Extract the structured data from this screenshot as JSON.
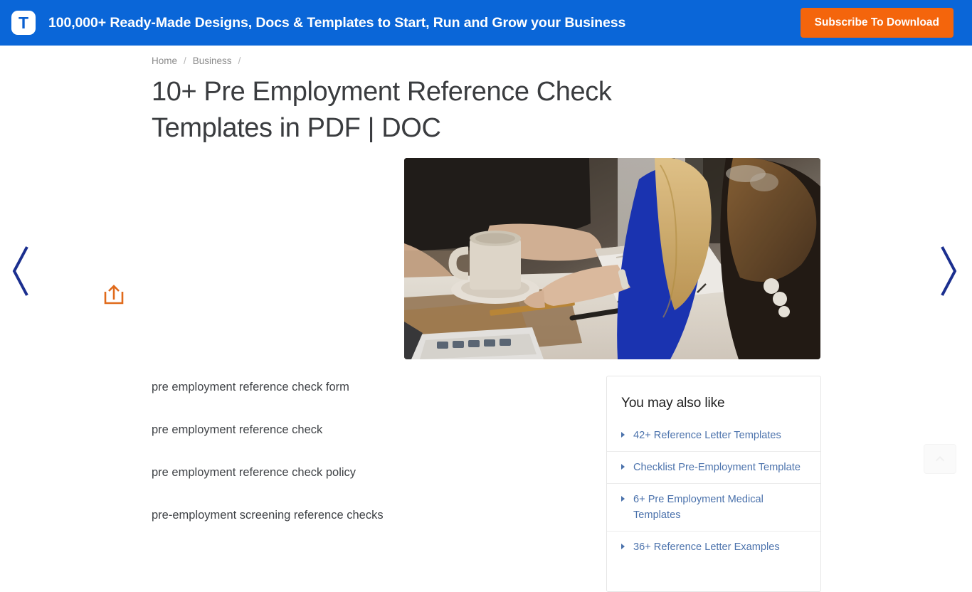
{
  "banner": {
    "logo_letter": "T",
    "logo_icon": "template-logo-icon",
    "promo_text": "100,000+ Ready-Made Designs, Docs & Templates to Start, Run and Grow your Business",
    "subscribe_label": "Subscribe To Download",
    "background_color": "#0a66d8",
    "subscribe_color": "#f4650c"
  },
  "breadcrumb": {
    "items": [
      {
        "label": "Home"
      },
      {
        "label": "Business"
      }
    ],
    "separator": "/"
  },
  "main": {
    "title": "10+ Pre Employment Reference Check Templates in PDF | DOC",
    "hero_image_alt": "Two people working at a desk with coffee mug, notebook and laptop",
    "share_icon": "share-upload-icon",
    "share_color": "#e06a1b",
    "prev_arrow_icon": "chevron-left-icon",
    "next_arrow_icon": "chevron-right-icon",
    "arrow_color": "#1b2f8f"
  },
  "keywords": [
    "pre employment reference check form",
    "pre employment reference check",
    "pre employment reference check policy",
    "pre-employment screening reference checks"
  ],
  "sidebar": {
    "title": "You may also like",
    "link_color": "#4b72ac",
    "items": [
      {
        "label": "42+ Reference Letter Templates"
      },
      {
        "label": "Checklist Pre-Employment Template"
      },
      {
        "label": "6+ Pre Employment Medical Templates"
      },
      {
        "label": "36+ Reference Letter Examples"
      }
    ]
  },
  "scroll_top": {
    "icon": "chevron-up-icon"
  }
}
